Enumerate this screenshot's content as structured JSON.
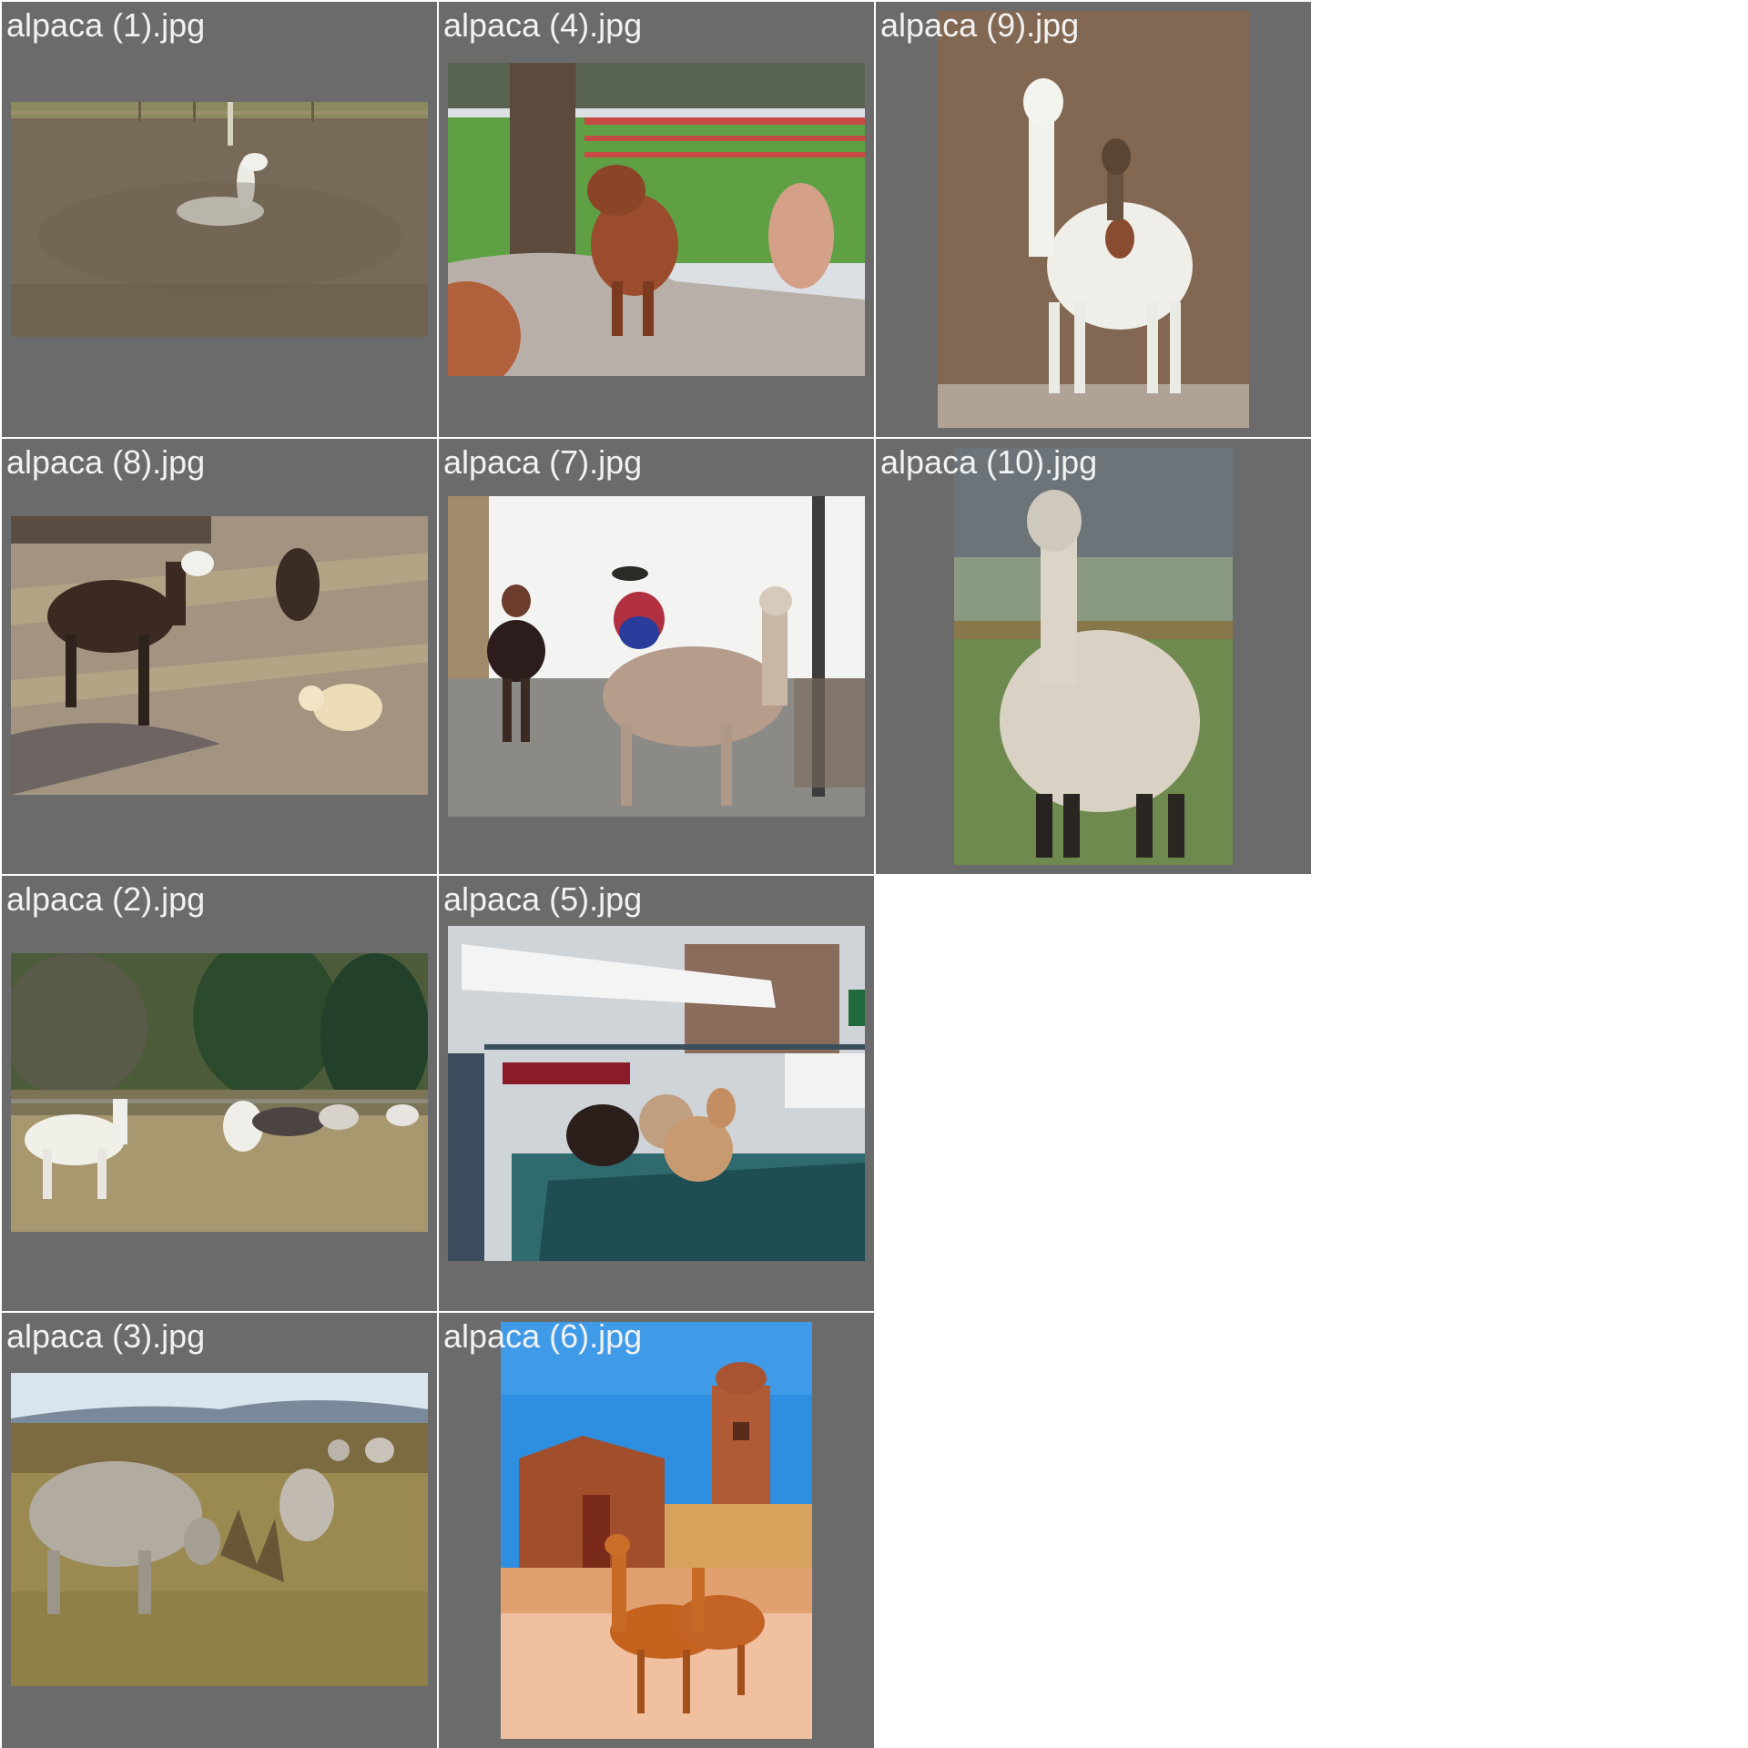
{
  "gallery": {
    "background": "#ffffff",
    "tile_color": "#6b6b6b",
    "caption_color": "#f2f2f2",
    "tiles": [
      {
        "filename": "alpaca (1).jpg"
      },
      {
        "filename": "alpaca (4).jpg"
      },
      {
        "filename": "alpaca (9).jpg"
      },
      {
        "filename": "alpaca (8).jpg"
      },
      {
        "filename": "alpaca (7).jpg"
      },
      {
        "filename": "alpaca (10).jpg"
      },
      {
        "filename": "alpaca (2).jpg"
      },
      {
        "filename": "alpaca (5).jpg"
      },
      {
        "filename": "alpaca (3).jpg"
      },
      {
        "filename": "alpaca (6).jpg"
      }
    ]
  }
}
